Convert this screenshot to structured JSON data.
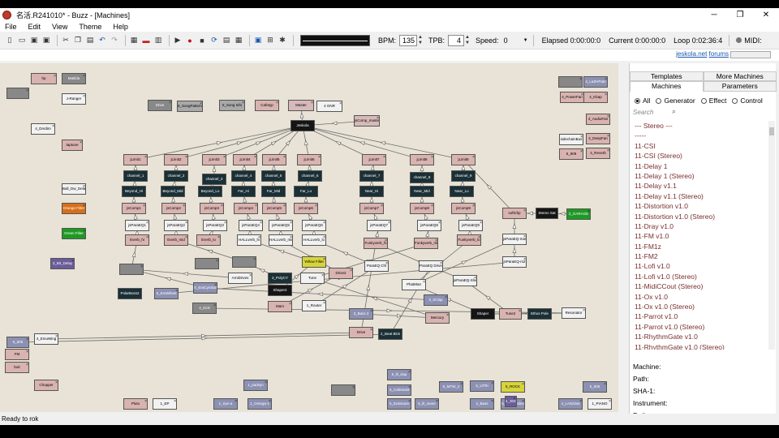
{
  "window": {
    "title": "名活.R241010* - Buzz - [Machines]",
    "minimize": "─",
    "maximize": "❐",
    "close": "✕"
  },
  "menu": [
    "File",
    "Edit",
    "View",
    "Theme",
    "Help"
  ],
  "toolbar": {
    "bpm_label": "BPM:",
    "bpm_value": "135",
    "tpb_label": "TPB:",
    "tpb_value": "4",
    "speed_label": "Speed:",
    "speed_value": "0",
    "elapsed": "Elapsed 0:00:00:0",
    "current": "Current 0:00:00:0",
    "loop": "Loop 0:02:36:4",
    "midi": "MIDI:"
  },
  "infobar": {
    "link": "jeskola.net",
    "link_suffix": "forums"
  },
  "sidebar": {
    "tabs_top": [
      "Templates",
      "More Machines"
    ],
    "tabs_bottom": [
      "Machines",
      "Parameters"
    ],
    "filters": [
      {
        "label": "All",
        "selected": true
      },
      {
        "label": "Generator",
        "selected": false
      },
      {
        "label": "Effect",
        "selected": false
      },
      {
        "label": "Control",
        "selected": false
      }
    ],
    "search_placeholder": "Search",
    "machine_list": [
      "--- Stereo ---",
      "-----",
      "11-CSI",
      "11-CSI (Stereo)",
      "11-Delay 1",
      "11-Delay 1 (Stereo)",
      "11-Delay v1.1",
      "11-Delay v1.1 (Stereo)",
      "11-Distortion v1.0",
      "11-Distortion v1.0 (Stereo)",
      "11-Dray v1.0",
      "11-FM v1.0",
      "11-FM1z",
      "11-FM2",
      "11-Lofi v1.0",
      "11-Lofi v1.0 (Stereo)",
      "11-MidiCCout (Stereo)",
      "11-Ox v1.0",
      "11-Ox v1.0 (Stereo)",
      "11-Parrot v1.0",
      "11-Parrot v1.0 (Stereo)",
      "11-RhythmGate v1.0",
      "11-RhythmGate v1.0 (Stereo)"
    ],
    "properties": [
      "Machine:",
      "Path:",
      "SHA-1:",
      "Instrument:",
      "Path:"
    ]
  },
  "status": "Ready to rok",
  "machines": [
    {
      "label": "hp",
      "kind": "gen"
    },
    {
      "label": "Matilda",
      "kind": "img"
    },
    {
      "label": "",
      "kind": "img"
    },
    {
      "label": "J-Ranger",
      "kind": "white"
    },
    {
      "label": "Drive",
      "kind": "img"
    },
    {
      "label": "6_SongPattern",
      "kind": "ctl"
    },
    {
      "label": "0_Song Info",
      "kind": "ctl"
    },
    {
      "label": "Cafetyp",
      "kind": "gen"
    },
    {
      "label": "Master",
      "kind": "pink"
    },
    {
      "label": "4 GNR",
      "kind": "white"
    },
    {
      "label": "jsComp_master",
      "kind": "pink"
    },
    {
      "label": "Jeskola",
      "kind": "blk"
    },
    {
      "label": "4_Dnrdim",
      "kind": "white"
    },
    {
      "label": "taptune",
      "kind": "gen"
    },
    {
      "label": "jLimit1",
      "kind": "gen"
    },
    {
      "label": "jLimit2",
      "kind": "gen"
    },
    {
      "label": "jLimit3",
      "kind": "gen"
    },
    {
      "label": "jLimit4",
      "kind": "gen"
    },
    {
      "label": "jLimit5",
      "kind": "gen"
    },
    {
      "label": "jLimit6",
      "kind": "gen"
    },
    {
      "label": "jLimit7",
      "kind": "gen"
    },
    {
      "label": "jLimit8",
      "kind": "gen"
    },
    {
      "label": "jLimit9",
      "kind": "gen"
    },
    {
      "label": "channel_1",
      "kind": "dark"
    },
    {
      "label": "channel_2",
      "kind": "dark"
    },
    {
      "label": "channel_3",
      "kind": "dark"
    },
    {
      "label": "channel_4",
      "kind": "dark"
    },
    {
      "label": "channel_5",
      "kind": "dark"
    },
    {
      "label": "channel_6",
      "kind": "dark"
    },
    {
      "label": "channel_7",
      "kind": "dark"
    },
    {
      "label": "channel_8",
      "kind": "dark"
    },
    {
      "label": "channel_9",
      "kind": "dark"
    },
    {
      "label": "Beyond_Hi",
      "kind": "dark"
    },
    {
      "label": "Beyond_Mid",
      "kind": "dark"
    },
    {
      "label": "Beyond_Lo",
      "kind": "dark"
    },
    {
      "label": "Far_Hi",
      "kind": "dark"
    },
    {
      "label": "Far_Mid",
      "kind": "dark"
    },
    {
      "label": "Far_Lo",
      "kind": "dark"
    },
    {
      "label": "Near_Hi",
      "kind": "dark"
    },
    {
      "label": "Near_Mid",
      "kind": "dark"
    },
    {
      "label": "Near_Lo",
      "kind": "dark"
    },
    {
      "label": "Ball_Dw_Delay",
      "kind": "white"
    },
    {
      "label": "Orange Filter",
      "kind": "orange"
    },
    {
      "label": "Green Filter",
      "kind": "green"
    },
    {
      "label": "jsComp1",
      "kind": "gen"
    },
    {
      "label": "jsComp2",
      "kind": "gen"
    },
    {
      "label": "jsComp3",
      "kind": "gen"
    },
    {
      "label": "jsComp4",
      "kind": "gen"
    },
    {
      "label": "jsComp5",
      "kind": "gen"
    },
    {
      "label": "jsComp6",
      "kind": "gen"
    },
    {
      "label": "jsComp7",
      "kind": "gen"
    },
    {
      "label": "jsComp8",
      "kind": "gen"
    },
    {
      "label": "jsComp9",
      "kind": "gen"
    },
    {
      "label": "softClip",
      "kind": "gen"
    },
    {
      "label": "Stereo Sat",
      "kind": "blk"
    },
    {
      "label": "2_GARAGE",
      "kind": "green"
    },
    {
      "label": "jsParaEQ1",
      "kind": "white"
    },
    {
      "label": "jsParaEQ2",
      "kind": "white"
    },
    {
      "label": "jsParaEQ3",
      "kind": "white"
    },
    {
      "label": "jsParaEQ4",
      "kind": "white"
    },
    {
      "label": "jsParaEQ5",
      "kind": "white"
    },
    {
      "label": "jsParaEQ6",
      "kind": "white"
    },
    {
      "label": "jsParaEQ7",
      "kind": "white"
    },
    {
      "label": "jsParaEQ8",
      "kind": "white"
    },
    {
      "label": "jsParaEQ9",
      "kind": "white"
    },
    {
      "label": "Everb_hi",
      "kind": "gen"
    },
    {
      "label": "Everb_mid",
      "kind": "gen"
    },
    {
      "label": "Everb_lo",
      "kind": "gen"
    },
    {
      "label": "HALLverb_hi",
      "kind": "white"
    },
    {
      "label": "HALLverb_mid",
      "kind": "white"
    },
    {
      "label": "HALLverb_lo",
      "kind": "white"
    },
    {
      "label": "Funkyverb_hi",
      "kind": "gen"
    },
    {
      "label": "Funkyverb_mid",
      "kind": "gen"
    },
    {
      "label": "Funkyverb_lo",
      "kind": "gen"
    },
    {
      "label": "jsParaEQ-master",
      "kind": "white"
    },
    {
      "label": "jsParaEQ-m2",
      "kind": "white"
    },
    {
      "label": "3_Bit_Delay",
      "kind": "purple"
    },
    {
      "label": "",
      "kind": "img"
    },
    {
      "label": "",
      "kind": "img"
    },
    {
      "label": "",
      "kind": "img"
    },
    {
      "label": "Yellow Filter",
      "kind": "yellow"
    },
    {
      "label": "Drive2",
      "kind": "gen"
    },
    {
      "label": "ParaEQ Chl",
      "kind": "white"
    },
    {
      "label": "ParaEQ Drive",
      "kind": "white"
    },
    {
      "label": "jsParaEQ-Slow",
      "kind": "white"
    },
    {
      "label": "Tune",
      "kind": "white"
    },
    {
      "label": "PhatMan",
      "kind": "white"
    },
    {
      "label": "PolarBoss2",
      "kind": "dark"
    },
    {
      "label": "5_EraWheel",
      "kind": "eff"
    },
    {
      "label": "5_EraCymbal",
      "kind": "eff"
    },
    {
      "label": "ArniDrives",
      "kind": "white"
    },
    {
      "label": "3_PolyCY",
      "kind": "dark"
    },
    {
      "label": "Shaper2",
      "kind": "blk"
    },
    {
      "label": "Mars",
      "kind": "gen"
    },
    {
      "label": "1_Router",
      "kind": "white"
    },
    {
      "label": "Tune2",
      "kind": "gen"
    },
    {
      "label": "Shaper",
      "kind": "blk"
    },
    {
      "label": "Ethos Pole",
      "kind": "dark"
    },
    {
      "label": "Resonator",
      "kind": "white"
    },
    {
      "label": "4_Kick",
      "kind": "img"
    },
    {
      "label": "3_SClap",
      "kind": "eff"
    },
    {
      "label": "Mercury",
      "kind": "gen"
    },
    {
      "label": "3_Bass 2",
      "kind": "eff"
    },
    {
      "label": "Drive",
      "kind": "gen"
    },
    {
      "label": "2_Beat Blck",
      "kind": "dark"
    },
    {
      "label": "5_505",
      "kind": "eff"
    },
    {
      "label": "4_EmuWing",
      "kind": "white"
    },
    {
      "label": "FM",
      "kind": "gen"
    },
    {
      "label": "boit",
      "kind": "gen"
    },
    {
      "label": "Chopper",
      "kind": "gen"
    },
    {
      "label": "Pluto",
      "kind": "gen"
    },
    {
      "label": "1_EP",
      "kind": "white"
    },
    {
      "label": "1_Syn-a",
      "kind": "eff"
    },
    {
      "label": "1_padsyn",
      "kind": "eff"
    },
    {
      "label": "1_Omega-1",
      "kind": "eff"
    },
    {
      "label": "",
      "kind": "img"
    },
    {
      "label": "5_lil_clap",
      "kind": "eff"
    },
    {
      "label": "5_Cafetsold",
      "kind": "eff"
    },
    {
      "label": "5_EraSnare",
      "kind": "eff"
    },
    {
      "label": "5_lil_snare",
      "kind": "eff"
    },
    {
      "label": "5_MTW_2",
      "kind": "eff"
    },
    {
      "label": "5_UTRi",
      "kind": "eff"
    },
    {
      "label": "5_ROCK",
      "kind": "yellow"
    },
    {
      "label": "2_Bass",
      "kind": "eff"
    },
    {
      "label": "5_EraCoedex",
      "kind": "eff"
    },
    {
      "label": "5_505",
      "kind": "eff"
    },
    {
      "label": "4_LAS22wt",
      "kind": "eff"
    },
    {
      "label": "1_PIANO",
      "kind": "white"
    },
    {
      "label": "",
      "kind": "img"
    },
    {
      "label": "4_LaZHPatn",
      "kind": "eff"
    },
    {
      "label": "4_PowerFan",
      "kind": "gen"
    },
    {
      "label": "4_Kbap",
      "kind": "gen"
    },
    {
      "label": "4_AudioFan",
      "kind": "gen"
    },
    {
      "label": "sidechainBus",
      "kind": "white"
    },
    {
      "label": "4_DeepFan",
      "kind": "gen"
    },
    {
      "label": "5_909",
      "kind": "gen"
    },
    {
      "label": "4_Reverb",
      "kind": "gen"
    },
    {
      "label": "4_303",
      "kind": "purple"
    }
  ]
}
